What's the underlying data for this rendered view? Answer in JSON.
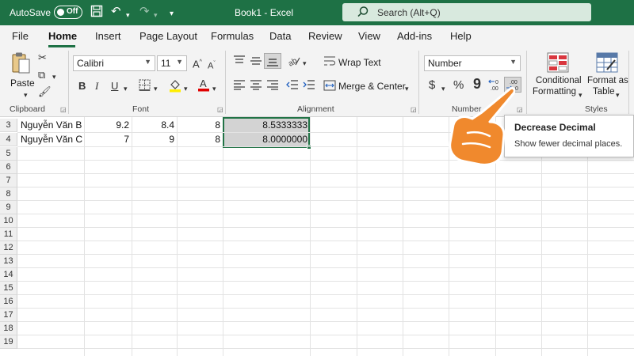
{
  "titlebar": {
    "autosave_label": "AutoSave",
    "autosave_state": "Off",
    "doc_title": "Book1  -  Excel",
    "search_placeholder": "Search (Alt+Q)"
  },
  "tabs": [
    "File",
    "Home",
    "Insert",
    "Page Layout",
    "Formulas",
    "Data",
    "Review",
    "View",
    "Add-ins",
    "Help"
  ],
  "active_tab": "Home",
  "ribbon": {
    "clipboard": {
      "paste_label": "Paste",
      "group_label": "Clipboard"
    },
    "font": {
      "font_name": "Calibri",
      "font_size": "11",
      "group_label": "Font",
      "bold": "B",
      "italic": "I",
      "underline": "U"
    },
    "alignment": {
      "wrap_text": "Wrap Text",
      "merge_center": "Merge & Center",
      "group_label": "Alignment"
    },
    "number": {
      "format": "Number",
      "group_label": "Number",
      "currency": "$",
      "percent": "%",
      "comma": "9"
    },
    "styles": {
      "conditional": "Conditional",
      "formatting": "Formatting",
      "format_as": "Format as",
      "table": "Table",
      "group_label": "Styles"
    }
  },
  "grid": {
    "rows": [
      {
        "num": "3",
        "name": "Nguyễn Văn B",
        "b": "9.2",
        "c": "8.4",
        "d": "8",
        "e": "8.5333333"
      },
      {
        "num": "4",
        "name": "Nguyễn Văn C",
        "b": "7",
        "c": "9",
        "d": "8",
        "e": "8.0000000"
      }
    ],
    "empty_rows": [
      "5",
      "6",
      "7",
      "8",
      "9",
      "10",
      "11",
      "12",
      "13",
      "14",
      "15",
      "16",
      "17",
      "18",
      "19"
    ]
  },
  "tooltip": {
    "title": "Decrease Decimal",
    "description": "Show fewer decimal places."
  },
  "colors": {
    "accent": "#1e7145",
    "selection_border": "#217346",
    "hand": "#f0892d"
  }
}
